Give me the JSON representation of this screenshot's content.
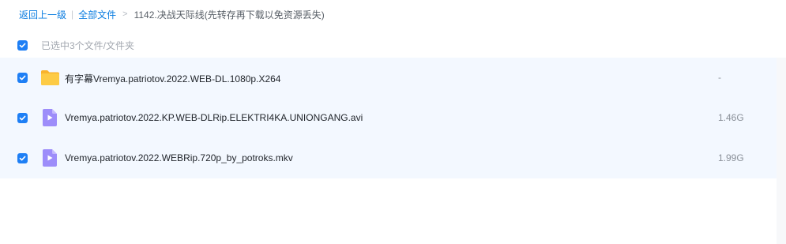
{
  "breadcrumb": {
    "back_label": "返回上一级",
    "separator": "|",
    "all_files_label": "全部文件",
    "arrow": ">",
    "current_folder": "1142.决战天际线(先转存再下载以免资源丢失)"
  },
  "selection": {
    "summary": "已选中3个文件/文件夹"
  },
  "files": [
    {
      "type": "folder",
      "name": "有字幕Vremya.patriotov.2022.WEB-DL.1080p.X264",
      "size": "-",
      "checked": true
    },
    {
      "type": "video",
      "name": "Vremya.patriotov.2022.KP.WEB-DLRip.ELEKTRI4KA.UNIONGANG.avi",
      "size": "1.46G",
      "checked": true
    },
    {
      "type": "video",
      "name": "Vremya.patriotov.2022.WEBRip.720p_by_potroks.mkv",
      "size": "1.99G",
      "checked": true
    }
  ],
  "colors": {
    "accent": "#1e7ff5",
    "link": "#0a7ce0",
    "row_highlight": "#f3f8ff",
    "folder": "#fcc23a",
    "video_icon": "#9d8dfa"
  }
}
